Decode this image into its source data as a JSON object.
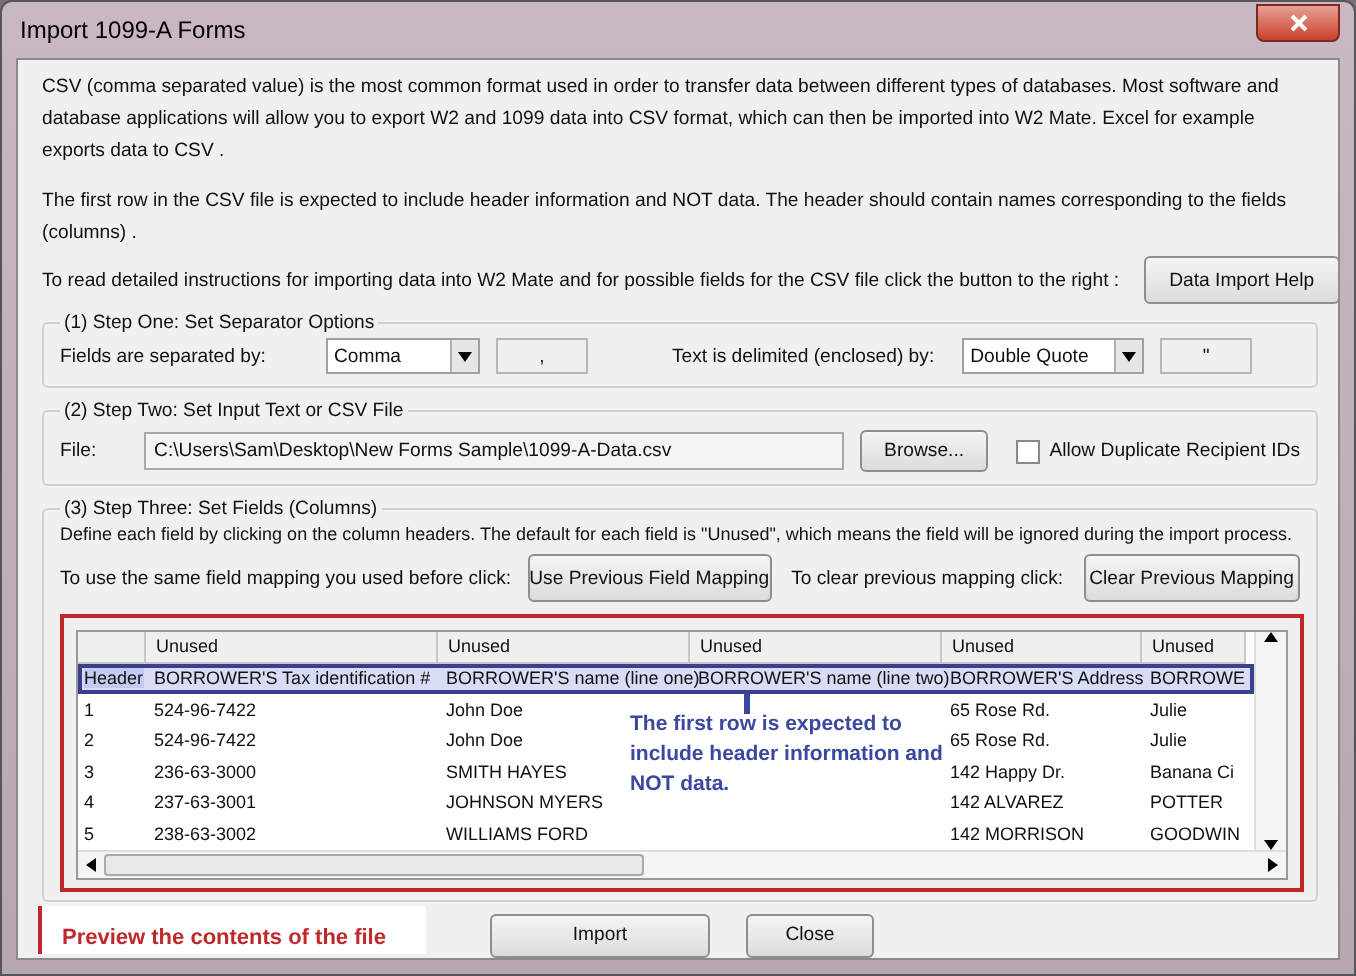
{
  "window": {
    "title": "Import 1099-A Forms"
  },
  "intro": [
    "CSV (comma separated value) is the most common format used in order to transfer data between different types of databases.  Most software and database applications will allow you to export W2 and 1099 data into CSV format, which can then be imported into W2 Mate. Excel for example exports data to CSV .",
    "The first row in the CSV file is expected to include header information and NOT data. The header should contain names corresponding to the fields (columns) ."
  ],
  "help": {
    "text": "To read detailed instructions for importing data into W2 Mate and for possible fields for the CSV file click the button to the right :",
    "button": "Data Import Help"
  },
  "step1": {
    "legend": "(1)  Step One: Set Separator Options",
    "fields_label": "Fields are separated by:",
    "fields_select": "Comma",
    "fields_char": ",",
    "text_label": "Text is delimited (enclosed) by:",
    "text_select": "Double Quote",
    "text_char": "\""
  },
  "step2": {
    "legend": "(2)  Step Two: Set Input Text or CSV File",
    "file_label": "File:",
    "file_path": "C:\\Users\\Sam\\Desktop\\New Forms Sample\\1099-A-Data.csv",
    "browse_button": "Browse...",
    "allow_duplicates": {
      "label": "Allow Duplicate Recipient IDs",
      "checked": false
    }
  },
  "step3": {
    "legend": "(3)  Step Three: Set Fields (Columns)",
    "description": "Define each field by clicking on the column headers. The default for each field is \"Unused\", which means the field will be ignored during the import process.",
    "prev_label": "To use the same field mapping you used before click:",
    "prev_button": "Use Previous Field Mapping",
    "clear_label": "To clear previous mapping click:",
    "clear_button": "Clear Previous Mapping"
  },
  "grid": {
    "columns": [
      "Unused",
      "Unused",
      "Unused",
      "Unused",
      "Unused"
    ],
    "rows": [
      {
        "label": "Header",
        "selected": true,
        "cells": [
          "BORROWER'S Tax identification #",
          "BORROWER'S name (line one)",
          "BORROWER'S name (line two)",
          "BORROWER'S Address",
          "BORROWE"
        ]
      },
      {
        "label": "1",
        "selected": false,
        "cells": [
          "524-96-7422",
          "John Doe",
          "",
          "65 Rose Rd.",
          "Julie"
        ]
      },
      {
        "label": "2",
        "selected": false,
        "cells": [
          "524-96-7422",
          "John Doe",
          "",
          "65 Rose Rd.",
          "Julie"
        ]
      },
      {
        "label": "3",
        "selected": false,
        "cells": [
          "236-63-3000",
          "SMITH HAYES",
          "",
          "142 Happy Dr.",
          "Banana Ci"
        ]
      },
      {
        "label": "4",
        "selected": false,
        "cells": [
          "237-63-3001",
          "JOHNSON MYERS",
          "",
          "142 ALVAREZ",
          "POTTER"
        ]
      },
      {
        "label": "5",
        "selected": false,
        "cells": [
          "238-63-3002",
          "WILLIAMS FORD",
          "",
          "142 MORRISON",
          "GOODWIN"
        ]
      }
    ]
  },
  "callout": "The first row is expected to include header information and NOT data.",
  "preview_caption": "Preview the contents of the file",
  "buttons": [
    "Import",
    "Close"
  ]
}
